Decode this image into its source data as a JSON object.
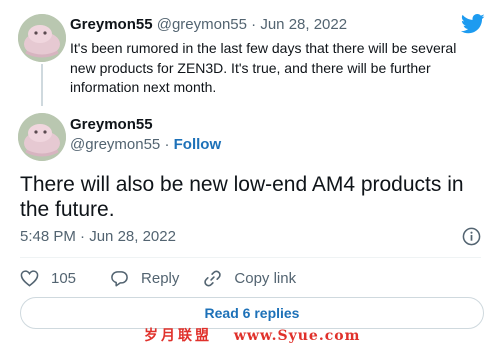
{
  "tweet1": {
    "name": "Greymon55",
    "handle": "@greymon55",
    "separator": "·",
    "date": "Jun 28, 2022",
    "text_line1": "It's been rumored in the last few days that there will be several",
    "text_line2": "new products for ZEN3D. It's true, and there will be further",
    "text_line3": "information next month."
  },
  "tweet2": {
    "name": "Greymon55",
    "handle": "@greymon55",
    "separator": "·",
    "follow_label": "Follow",
    "text": "There will also be new low-end AM4 products in the future.",
    "time": "5:48 PM",
    "date": "Jun 28, 2022",
    "like_count": "105",
    "reply_label": "Reply",
    "copy_link_label": "Copy link",
    "read_replies_label": "Read 6 replies"
  },
  "watermark": {
    "cjk": "岁月联盟",
    "site": "www.Syue.com"
  },
  "icons": {
    "brand": "twitter-bird-icon",
    "info": "info-icon",
    "like": "heart-icon",
    "reply": "reply-bubble-icon",
    "copy": "link-icon"
  },
  "colors": {
    "twitter_blue": "#1d9bf0",
    "link_blue": "#1d71b8",
    "secondary_text": "#536471",
    "watermark_red": "#e0312b"
  }
}
